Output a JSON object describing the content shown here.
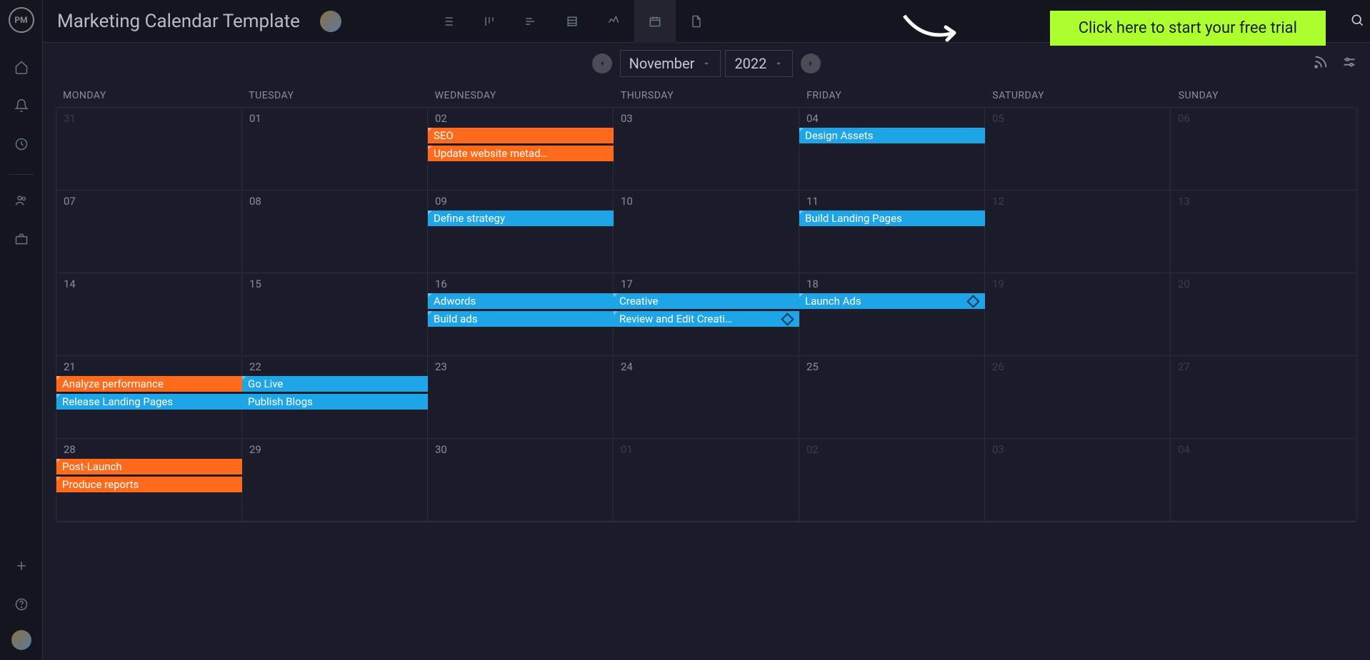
{
  "header": {
    "title": "Marketing Calendar Template",
    "cta": "Click here to start your free trial"
  },
  "nav": {
    "month": "November",
    "year": "2022"
  },
  "days": [
    "MONDAY",
    "TUESDAY",
    "WEDNESDAY",
    "THURSDAY",
    "FRIDAY",
    "SATURDAY",
    "SUNDAY"
  ],
  "cells": [
    {
      "n": "31",
      "fade": true
    },
    {
      "n": "01"
    },
    {
      "n": "02"
    },
    {
      "n": "03"
    },
    {
      "n": "04"
    },
    {
      "n": "05",
      "fade": true
    },
    {
      "n": "06",
      "fade": true
    },
    {
      "n": "07"
    },
    {
      "n": "08"
    },
    {
      "n": "09"
    },
    {
      "n": "10"
    },
    {
      "n": "11"
    },
    {
      "n": "12",
      "fade": true
    },
    {
      "n": "13",
      "fade": true
    },
    {
      "n": "14"
    },
    {
      "n": "15"
    },
    {
      "n": "16"
    },
    {
      "n": "17"
    },
    {
      "n": "18"
    },
    {
      "n": "19",
      "fade": true
    },
    {
      "n": "20",
      "fade": true
    },
    {
      "n": "21"
    },
    {
      "n": "22"
    },
    {
      "n": "23"
    },
    {
      "n": "24"
    },
    {
      "n": "25"
    },
    {
      "n": "26",
      "fade": true
    },
    {
      "n": "27",
      "fade": true
    },
    {
      "n": "28"
    },
    {
      "n": "29"
    },
    {
      "n": "30"
    },
    {
      "n": "01",
      "fade": true
    },
    {
      "n": "02",
      "fade": true
    },
    {
      "n": "03",
      "fade": true
    },
    {
      "n": "04",
      "fade": true
    }
  ],
  "events": [
    {
      "label": "SEO",
      "color": "orange",
      "row": 0,
      "col": 2,
      "span": 1,
      "slot": 0,
      "corner": true
    },
    {
      "label": "Update website metad…",
      "color": "orange",
      "row": 0,
      "col": 2,
      "span": 1,
      "slot": 1,
      "corner": true
    },
    {
      "label": "Design Assets",
      "color": "blue",
      "row": 0,
      "col": 4,
      "span": 1,
      "slot": 0,
      "corner": true
    },
    {
      "label": "Define strategy",
      "color": "blue",
      "row": 1,
      "col": 2,
      "span": 1,
      "slot": 0,
      "corner": true
    },
    {
      "label": "Build Landing Pages",
      "color": "blue",
      "row": 1,
      "col": 4,
      "span": 1,
      "slot": 0,
      "corner": true
    },
    {
      "label": "Adwords",
      "color": "blue",
      "row": 2,
      "col": 2,
      "span": 1,
      "slot": 0,
      "corner": true
    },
    {
      "label": "Build ads",
      "color": "blue",
      "row": 2,
      "col": 2,
      "span": 1,
      "slot": 1,
      "corner": true
    },
    {
      "label": "Creative",
      "color": "blue",
      "row": 2,
      "col": 3,
      "span": 1,
      "slot": 0,
      "corner": true
    },
    {
      "label": "Review and Edit Creati…",
      "color": "blue",
      "row": 2,
      "col": 3,
      "span": 1,
      "slot": 1,
      "corner": true,
      "diamond": true
    },
    {
      "label": "Launch Ads",
      "color": "blue",
      "row": 2,
      "col": 4,
      "span": 1,
      "slot": 0,
      "corner": true,
      "diamond": true
    },
    {
      "label": "Analyze performance",
      "color": "orange",
      "row": 3,
      "col": 0,
      "span": 1,
      "slot": 0,
      "corner": true
    },
    {
      "label": "Release Landing Pages",
      "color": "blue",
      "row": 3,
      "col": 0,
      "span": 1,
      "slot": 1,
      "corner": true
    },
    {
      "label": "Go Live",
      "color": "blue",
      "row": 3,
      "col": 1,
      "span": 1,
      "slot": 0,
      "corner": true
    },
    {
      "label": "Publish Blogs",
      "color": "blue",
      "row": 3,
      "col": 1,
      "span": 1,
      "slot": 1
    },
    {
      "label": "Post-Launch",
      "color": "orange",
      "row": 4,
      "col": 0,
      "span": 1,
      "slot": 0,
      "corner": true
    },
    {
      "label": "Produce reports",
      "color": "orange",
      "row": 4,
      "col": 0,
      "span": 1,
      "slot": 1,
      "corner": true
    }
  ]
}
